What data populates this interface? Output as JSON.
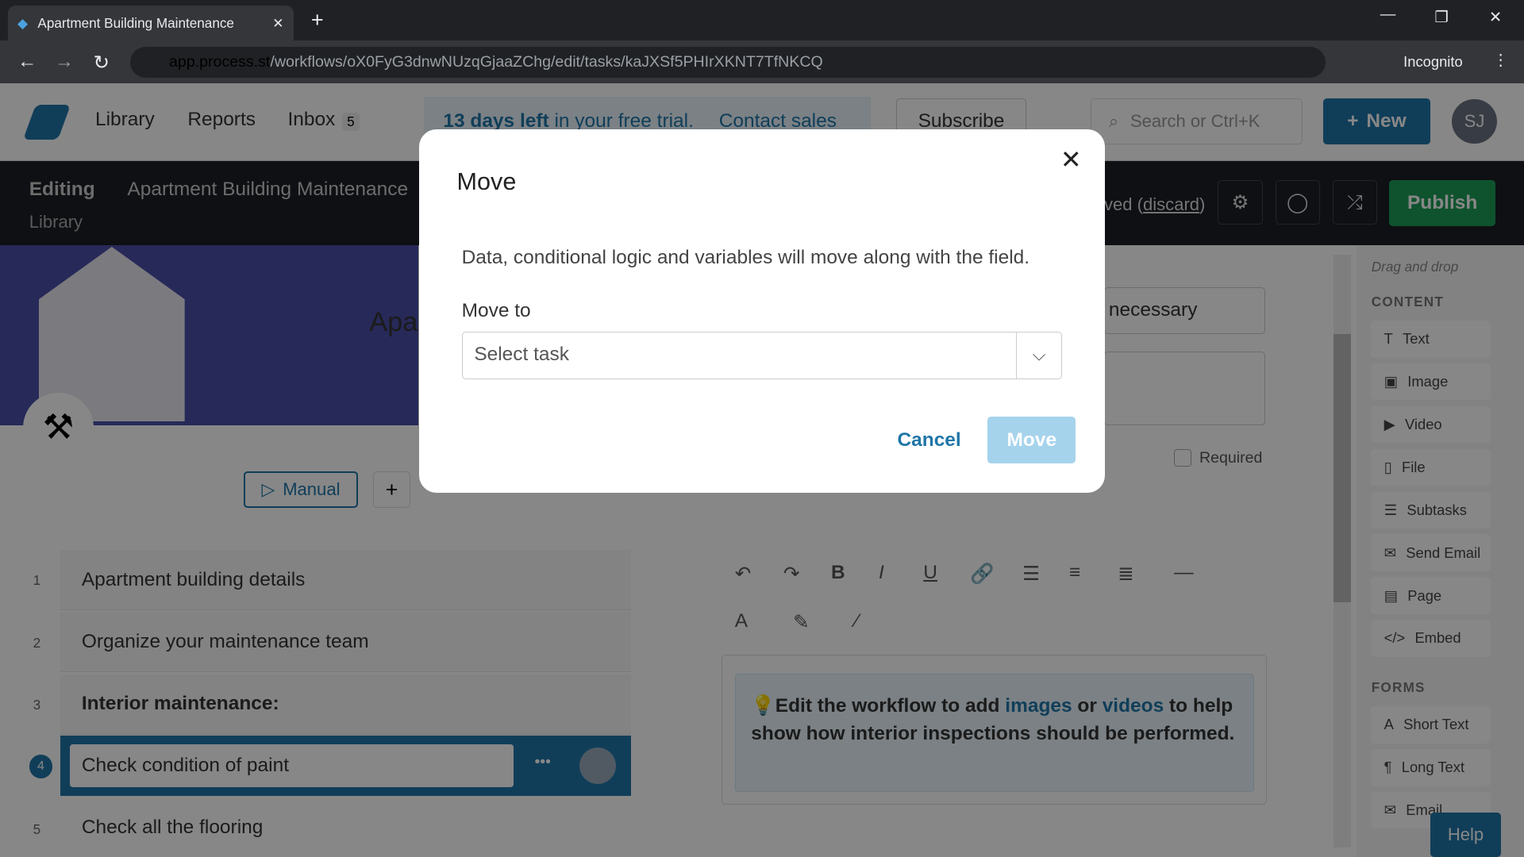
{
  "browser": {
    "tab_title": "Apartment Building Maintenance",
    "url_host": "app.process.st",
    "url_path": "/workflows/oX0FyG3dnwNUzqGjaaZChg/edit/tasks/kaJXSf5PHIrXKNT7TfNKCQ",
    "profile": "Incognito"
  },
  "nav": {
    "library": "Library",
    "reports": "Reports",
    "inbox": "Inbox",
    "inbox_count": "5",
    "trial_bold": "13 days left",
    "trial_rest": " in your free trial.",
    "contact": "Contact sales",
    "subscribe": "Subscribe",
    "search_placeholder": "Search or Ctrl+K",
    "new": "New",
    "avatar": "SJ"
  },
  "editbar": {
    "editing": "Editing",
    "title": "Apartment Building Maintenance",
    "breadcrumb": "Library",
    "saved": "ved",
    "discard": "discard",
    "publish": "Publish"
  },
  "header": {
    "title_part": "Apa",
    "manual": "Manual"
  },
  "tasks": [
    {
      "num": "1",
      "name": "Apartment building details"
    },
    {
      "num": "2",
      "name": "Organize your maintenance team"
    },
    {
      "num": "3",
      "name": "Interior maintenance:"
    },
    {
      "num": "4",
      "name": "Check condition of paint"
    },
    {
      "num": "5",
      "name": "Check all the flooring"
    }
  ],
  "editor": {
    "field_value": "necessary",
    "required": "Required",
    "callout_pre": "Edit the workflow to add ",
    "images": "images",
    "or": " or ",
    "videos": "videos",
    "callout_post": " to help show how interior inspections should be performed."
  },
  "sidebar": {
    "hint": "Drag and drop",
    "content_head": "CONTENT",
    "content": [
      "Text",
      "Image",
      "Video",
      "File",
      "Subtasks",
      "Send Email",
      "Page",
      "Embed"
    ],
    "forms_head": "FORMS",
    "forms": [
      "Short Text",
      "Long Text",
      "Email"
    ],
    "help": "Help"
  },
  "modal": {
    "title": "Move",
    "description": "Data, conditional logic and variables will move along with the field.",
    "move_to_label": "Move to",
    "select_placeholder": "Select task",
    "cancel": "Cancel",
    "move": "Move"
  },
  "colors": {
    "brand": "#1f76a8",
    "publish": "#1e9e57",
    "move_disabled": "#a6d3ec"
  }
}
